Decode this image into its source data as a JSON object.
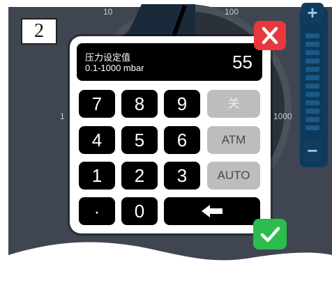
{
  "step": {
    "number": "2"
  },
  "gauge": {
    "labels": {
      "ten": "10",
      "hundred": "100",
      "one": "1",
      "thousand": "1000"
    }
  },
  "side_controls": {
    "plus_label": "+",
    "minus_label": "−"
  },
  "keypad": {
    "title": "压力设定值",
    "range": "0.1-1000 mbar",
    "value": "55",
    "keys": {
      "k7": "7",
      "k8": "8",
      "k9": "9",
      "off": "关",
      "k4": "4",
      "k5": "5",
      "k6": "6",
      "atm": "ATM",
      "k1": "1",
      "k2": "2",
      "k3": "3",
      "auto": "AUTO",
      "dot": "·",
      "k0": "0"
    }
  },
  "icons": {
    "close": "close-icon",
    "confirm": "checkmark-icon",
    "backspace": "arrow-left-icon"
  },
  "colors": {
    "close": "#e8383d",
    "confirm": "#2dbd4e",
    "key": "#000000",
    "key_disabled": "#bdbdbd",
    "background": "#3f4651"
  }
}
